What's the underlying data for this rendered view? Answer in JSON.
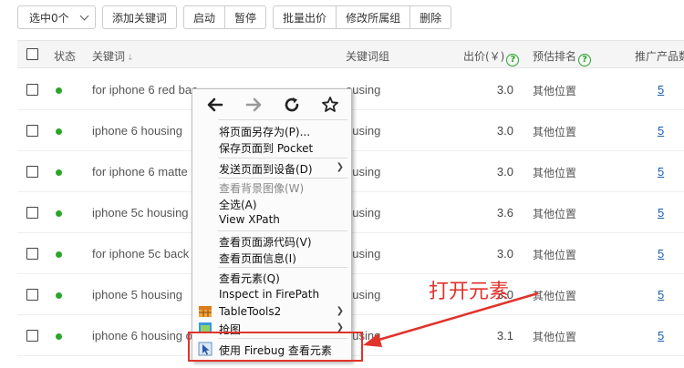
{
  "toolbar": {
    "select_label": "选中0个",
    "add_keyword": "添加关键词",
    "start": "启动",
    "pause": "暂停",
    "bulk_bid": "批量出价",
    "change_group": "修改所属组",
    "delete": "删除"
  },
  "table": {
    "headers": {
      "status": "状态",
      "keyword": "关键词",
      "group": "关键词组",
      "bid": "出价(￥)",
      "rank": "预估排名",
      "products": "推广产品数"
    },
    "rows": [
      {
        "keyword": "for iphone 6 red bac",
        "group": "ousing",
        "bid": "3.0",
        "rank": "其他位置",
        "products": "5"
      },
      {
        "keyword": "iphone 6 housing",
        "group": "ousing",
        "bid": "3.0",
        "rank": "其他位置",
        "products": "5"
      },
      {
        "keyword": "for iphone 6 matte b",
        "group": "ousing",
        "bid": "3.0",
        "rank": "其他位置",
        "products": "5"
      },
      {
        "keyword": "iphone 5c housing",
        "group": "ousing",
        "bid": "3.6",
        "rank": "其他位置",
        "products": "5"
      },
      {
        "keyword": "for iphone 5c back c",
        "group": "ousing",
        "bid": "3.0",
        "rank": "其他位置",
        "products": "5"
      },
      {
        "keyword": "iphone 5 housing",
        "group": "ousing",
        "bid": "3.0",
        "rank": "其他位置",
        "products": "5"
      },
      {
        "keyword": "iphone 6 housing o",
        "group": "ousing",
        "bid": "3.1",
        "rank": "其他位置",
        "products": "5"
      }
    ]
  },
  "context_menu": {
    "save_page_as": "将页面另存为(P)...",
    "save_to_pocket": "保存页面到 Pocket",
    "send_to_device": "发送页面到设备(D)",
    "view_bg_image": "查看背景图像(W)",
    "select_all": "全选(A)",
    "view_xpath": "View XPath",
    "view_source": "查看页面源代码(V)",
    "view_page_info": "查看页面信息(I)",
    "inspect_element": "查看元素(Q)",
    "inspect_firepath": "Inspect in FirePath",
    "tabletools": "TableTools2",
    "screenshot": "抢图",
    "firebug_inspect": "使用 Firebug 查看元素"
  },
  "annotation": "打开元素",
  "colors": {
    "accent_red": "#e0332b",
    "status_green": "#2aa52a",
    "link_blue": "#1a5fb4"
  }
}
